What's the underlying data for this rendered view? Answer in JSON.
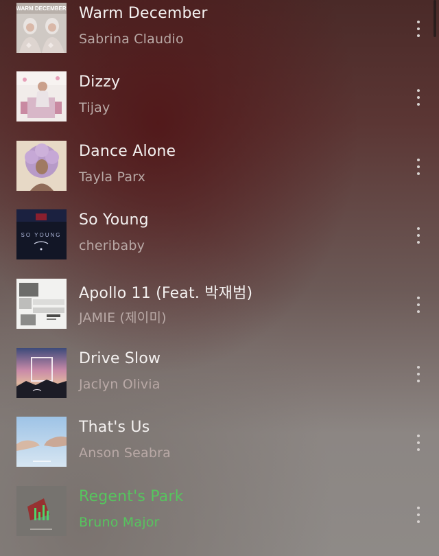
{
  "tracks": [
    {
      "title": "Warm December",
      "artist": "Sabrina Claudio",
      "art_icon": "album-art-warm-december",
      "art_text": "WARM DECEMBER"
    },
    {
      "title": "Dizzy",
      "artist": "Tijay",
      "art_icon": "album-art-dizzy"
    },
    {
      "title": "Dance Alone",
      "artist": "Tayla Parx",
      "art_icon": "album-art-dance-alone"
    },
    {
      "title": "So Young",
      "artist": "cheribaby",
      "art_icon": "album-art-so-young",
      "art_text": "SO YOUNG"
    },
    {
      "title": "Apollo 11 (Feat. 박재범)",
      "artist": "JAMIE (제이미)",
      "art_icon": "album-art-apollo-11"
    },
    {
      "title": "Drive Slow",
      "artist": "Jaclyn Olivia",
      "art_icon": "album-art-drive-slow"
    },
    {
      "title": "That's Us",
      "artist": "Anson Seabra",
      "art_icon": "album-art-thats-us"
    },
    {
      "title": "Regent's Park",
      "artist": "Bruno Major",
      "art_icon": "album-art-regents-park",
      "now_playing": true
    }
  ],
  "colors": {
    "title": "#f4f1f0",
    "artist": "#b9a9a6",
    "now_playing": "#56c55e"
  },
  "icons": {
    "more": "more-vertical-icon",
    "equalizer": "equalizer-icon"
  }
}
